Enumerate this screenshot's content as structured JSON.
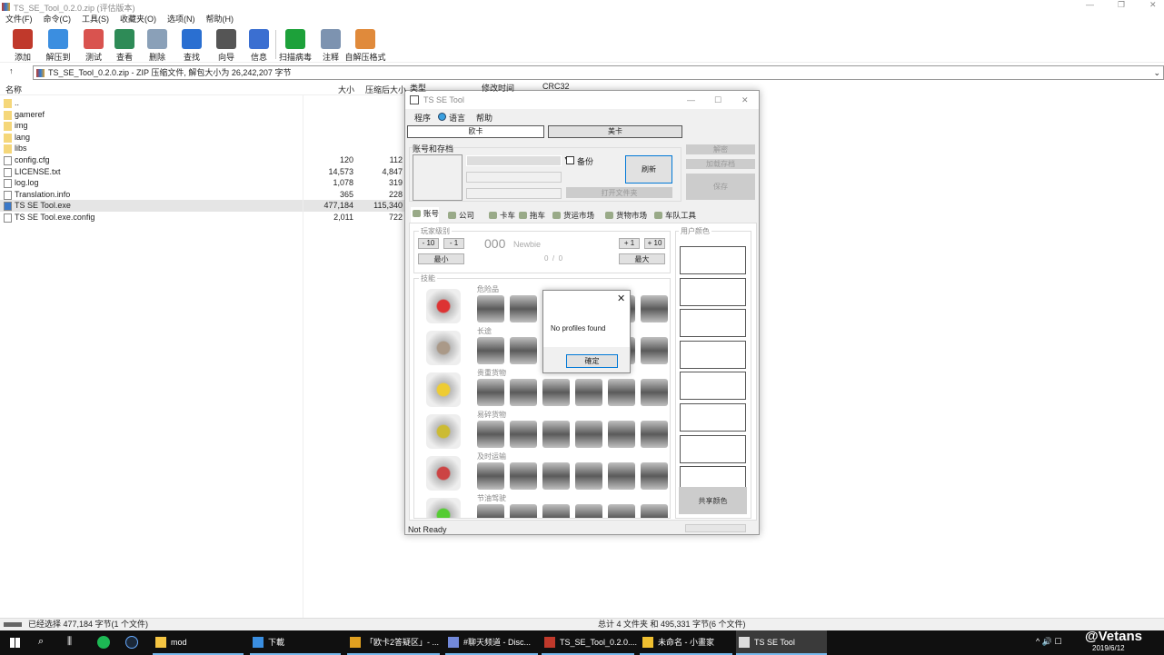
{
  "app": {
    "title": "TS_SE_Tool_0.2.0.zip (评估版本)"
  },
  "menu": [
    "文件(F)",
    "命令(C)",
    "工具(S)",
    "收藏夹(O)",
    "选项(N)",
    "帮助(H)"
  ],
  "toolbar": [
    {
      "label": "添加",
      "color": "#c0392b"
    },
    {
      "label": "解压到",
      "color": "#3b8ee0"
    },
    {
      "label": "测试",
      "color": "#d9534f"
    },
    {
      "label": "查看",
      "color": "#2e8b57"
    },
    {
      "label": "删除",
      "color": "#8aa0b8"
    },
    {
      "label": "查找",
      "color": "#2a6fd1"
    },
    {
      "label": "向导",
      "color": "#555"
    },
    {
      "label": "信息",
      "color": "#3b6fd1"
    },
    {
      "label": "扫描病毒",
      "color": "#1da13a"
    },
    {
      "label": "注释",
      "color": "#7d93b0"
    },
    {
      "label": "自解压格式",
      "color": "#e08a3b"
    }
  ],
  "address": "TS_SE_Tool_0.2.0.zip - ZIP 压缩文件, 解包大小为 26,242,207 字节",
  "columns": {
    "name": "名称",
    "size": "大小",
    "packed": "压缩后大小",
    "type": "类型",
    "modified": "修改时间",
    "crc": "CRC32"
  },
  "files": [
    {
      "name": "..",
      "size": "",
      "packed": "",
      "kind": "folder"
    },
    {
      "name": "gameref",
      "size": "",
      "packed": "",
      "kind": "folder"
    },
    {
      "name": "img",
      "size": "",
      "packed": "",
      "kind": "folder"
    },
    {
      "name": "lang",
      "size": "",
      "packed": "",
      "kind": "folder"
    },
    {
      "name": "libs",
      "size": "",
      "packed": "",
      "kind": "folder"
    },
    {
      "name": "config.cfg",
      "size": "120",
      "packed": "112",
      "kind": "file"
    },
    {
      "name": "LICENSE.txt",
      "size": "14,573",
      "packed": "4,847",
      "kind": "file"
    },
    {
      "name": "log.log",
      "size": "1,078",
      "packed": "319",
      "kind": "file"
    },
    {
      "name": "Translation.info",
      "size": "365",
      "packed": "228",
      "kind": "file"
    },
    {
      "name": "TS SE Tool.exe",
      "size": "477,184",
      "packed": "115,340",
      "kind": "exe"
    },
    {
      "name": "TS SE Tool.exe.config",
      "size": "2,011",
      "packed": "722",
      "kind": "file"
    }
  ],
  "status": {
    "left": "已经选择 477,184 字节(1 个文件)",
    "right": "总计 4 文件夹 和 495,331 字节(6 个文件)"
  },
  "tool": {
    "title": "TS SE Tool",
    "menu": [
      "程序",
      "语言",
      "帮助"
    ],
    "game_ets": "欧卡",
    "game_ats": "美卡",
    "profiles_group": "账号和存档",
    "backup": "备份",
    "refresh": "刷新",
    "open_folder": "打开文件夹",
    "decode": "解密",
    "load_save": "加载存档",
    "save": "保存",
    "tabs": [
      "账号",
      "公司",
      "卡车",
      "拖车",
      "货运市场",
      "货物市场",
      "车队工具"
    ],
    "level_group": "玩家级别",
    "minus10": "- 10",
    "minus1": "- 1",
    "plus1": "+ 1",
    "plus10": "+ 10",
    "min": "最小",
    "max": "最大",
    "level": "000",
    "rank": "Newbie",
    "xp": "0  /  0",
    "skills_group": "技能",
    "skills": [
      "危险品",
      "长途",
      "贵重货物",
      "易碎货物",
      "及时运输",
      "节油驾驶"
    ],
    "colors_group": "用户颜色",
    "share_colors": "共享颜色",
    "status": "Not Ready"
  },
  "dialog": {
    "message": "No profiles found",
    "ok": "確定"
  },
  "taskbar": {
    "items": [
      "mod",
      "下載",
      "「欧卡2答疑区」- ...",
      "#聊天频道 - Disc...",
      "TS_SE_Tool_0.2.0....",
      "未命名 - 小畫家",
      "TS SE Tool"
    ],
    "date": "2019/6/12",
    "watermark": "@Vetans"
  }
}
